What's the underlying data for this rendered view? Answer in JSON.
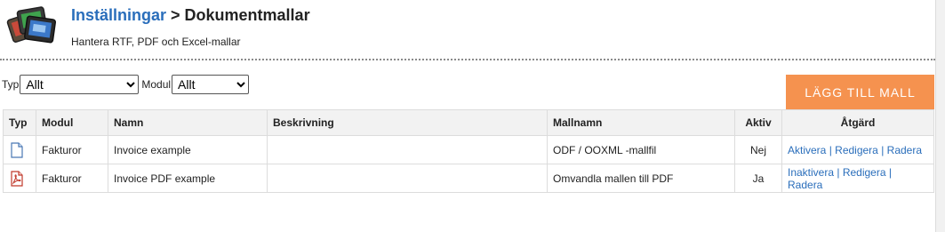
{
  "header": {
    "breadcrumb_link": "Inställningar",
    "breadcrumb_sep": " > ",
    "page_title": "Dokumentmallar",
    "subtitle": "Hantera RTF, PDF och Excel-mallar"
  },
  "filters": {
    "type_label": "Typ",
    "type_value": "Allt",
    "module_label": "Modul",
    "module_value": "Allt"
  },
  "add_button": "LÄGG TILL MALL",
  "table": {
    "columns": [
      "Typ",
      "Modul",
      "Namn",
      "Beskrivning",
      "Mallnamn",
      "Aktiv",
      "Åtgärd"
    ],
    "rows": [
      {
        "type_icon": "document-icon",
        "module": "Fakturor",
        "name": "Invoice example",
        "description": "",
        "template": "ODF / OOXML -mallfil",
        "active": "Nej",
        "actions": [
          "Aktivera",
          "Redigera",
          "Radera"
        ]
      },
      {
        "type_icon": "pdf-icon",
        "module": "Fakturor",
        "name": "Invoice PDF example",
        "description": "",
        "template": "Omvandla mallen till PDF",
        "active": "Ja",
        "actions": [
          "Inaktivera",
          "Redigera",
          "Radera"
        ]
      }
    ],
    "action_separator": " | "
  },
  "colors": {
    "link": "#2a6ebb",
    "button": "#f5924f",
    "inactive": "#d8362a",
    "header_bg": "#f2f2f2"
  }
}
